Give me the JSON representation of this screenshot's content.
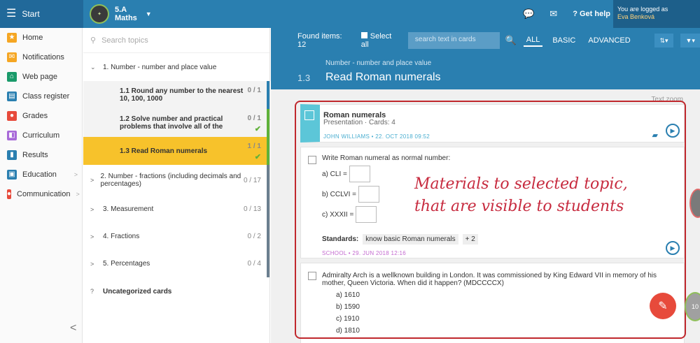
{
  "topbar": {
    "start": "Start",
    "class_name": "5.A",
    "subject": "Maths",
    "help": "Get help",
    "logged_label": "You are logged as",
    "user": "Eva Benková"
  },
  "sidebar": {
    "items": [
      {
        "label": "Home",
        "icon": "star-icon",
        "color": "#f5a623"
      },
      {
        "label": "Notifications",
        "icon": "envelope-icon",
        "color": "#f5a623"
      },
      {
        "label": "Web page",
        "icon": "home-icon",
        "color": "#1a9a6a"
      },
      {
        "label": "Class register",
        "icon": "book-icon",
        "color": "#2a7fb0"
      },
      {
        "label": "Grades",
        "icon": "grades-icon",
        "color": "#e74a3b"
      },
      {
        "label": "Curriculum",
        "icon": "curriculum-icon",
        "color": "#a86ad8"
      },
      {
        "label": "Results",
        "icon": "chart-icon",
        "color": "#2a7fb0"
      },
      {
        "label": "Education",
        "icon": "education-icon",
        "color": "#2a7fb0"
      },
      {
        "label": "Communication",
        "icon": "chat-icon",
        "color": "#e74a3b"
      }
    ]
  },
  "topics": {
    "search_placeholder": "Search topics",
    "items": [
      {
        "label": "1. Number - number and place value",
        "count": ""
      },
      {
        "label": "1.1 Round any number to the nearest 10, 100, 1000",
        "count": "0 / 1"
      },
      {
        "label": "1.2 Solve number and practical problems that involve all of the",
        "count": "0 / 1"
      },
      {
        "label": "1.3 Read Roman numerals",
        "count": "1 / 1"
      },
      {
        "label": "2. Number - fractions (including decimals and percentages)",
        "count": "0 / 17"
      },
      {
        "label": "3. Measurement",
        "count": "0 / 13"
      },
      {
        "label": "4. Fractions",
        "count": "0 / 2"
      },
      {
        "label": "5. Percentages",
        "count": "0 / 4"
      },
      {
        "label": "Uncategorized cards",
        "count": ""
      }
    ]
  },
  "main": {
    "found": "Found items: 12",
    "select_all": "Select all",
    "search_placeholder": "search text in cards",
    "filters": [
      "ALL",
      "BASIC",
      "ADVANCED"
    ],
    "breadcrumb": "Number - number and place value",
    "topic_num": "1.3",
    "topic_title": "Read Roman numerals",
    "text_zoom": "Text zoom"
  },
  "cards": {
    "c1": {
      "title": "Roman numerals",
      "subtitle": "Presentation · Cards: 4",
      "meta": "JOHN WILLIAMS  •  22. OCT 2018 09:52"
    },
    "c2": {
      "question": "Write Roman numeral as normal number:",
      "a": "a) CLI =",
      "b": "b) CCLVI =",
      "c": "c) XXXII =",
      "standards_label": "Standards:",
      "tag": "know basic Roman numerals",
      "more": "+ 2",
      "meta": "SCHOOL  •  29. JUN 2018 12:16"
    },
    "c3": {
      "question": "Admiralty Arch is a wellknown building in London. It was commissioned by King Edward VII in memory of his mother, Queen Victoria. When did it happen? (MDCCCCX)",
      "options": [
        "a)  1610",
        "b)  1590",
        "c)  1910",
        "d)  1810"
      ]
    }
  },
  "annotation": {
    "line1": "Materials to selected topic,",
    "line2": "that are visible to students"
  }
}
